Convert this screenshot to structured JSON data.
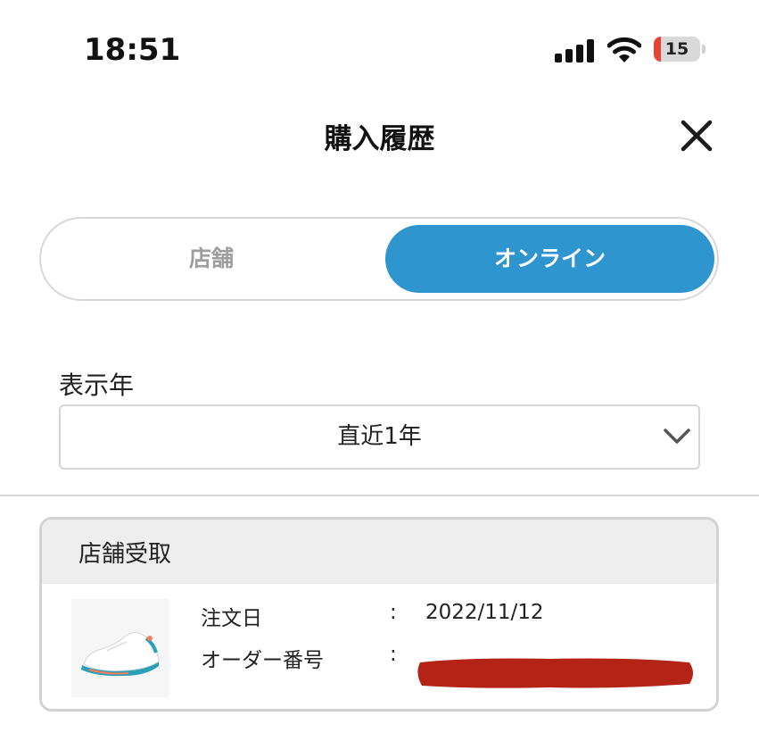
{
  "status_bar": {
    "time": "18:51",
    "battery_level": "15",
    "battery_fraction": 0.15,
    "battery_color": "#ea4335",
    "icons": [
      "signal-icon",
      "wifi-icon",
      "battery-icon"
    ]
  },
  "header": {
    "title": "購入履歴",
    "close_icon": "close-icon"
  },
  "segment": {
    "store_label": "店舗",
    "online_label": "オンライン",
    "selected": "online",
    "accent_color": "#2e95cf"
  },
  "year_filter": {
    "label": "表示年",
    "selected": "直近1年",
    "icon": "chevron-down-icon"
  },
  "orders": [
    {
      "type_label": "店舗受取",
      "product_icon": "sneaker-image",
      "date_label": "注文日",
      "date_value": "2022/11/12",
      "order_no_label": "オーダー番号",
      "separator": ":",
      "order_no_redacted": true,
      "redaction_color": "#b32417"
    }
  ]
}
